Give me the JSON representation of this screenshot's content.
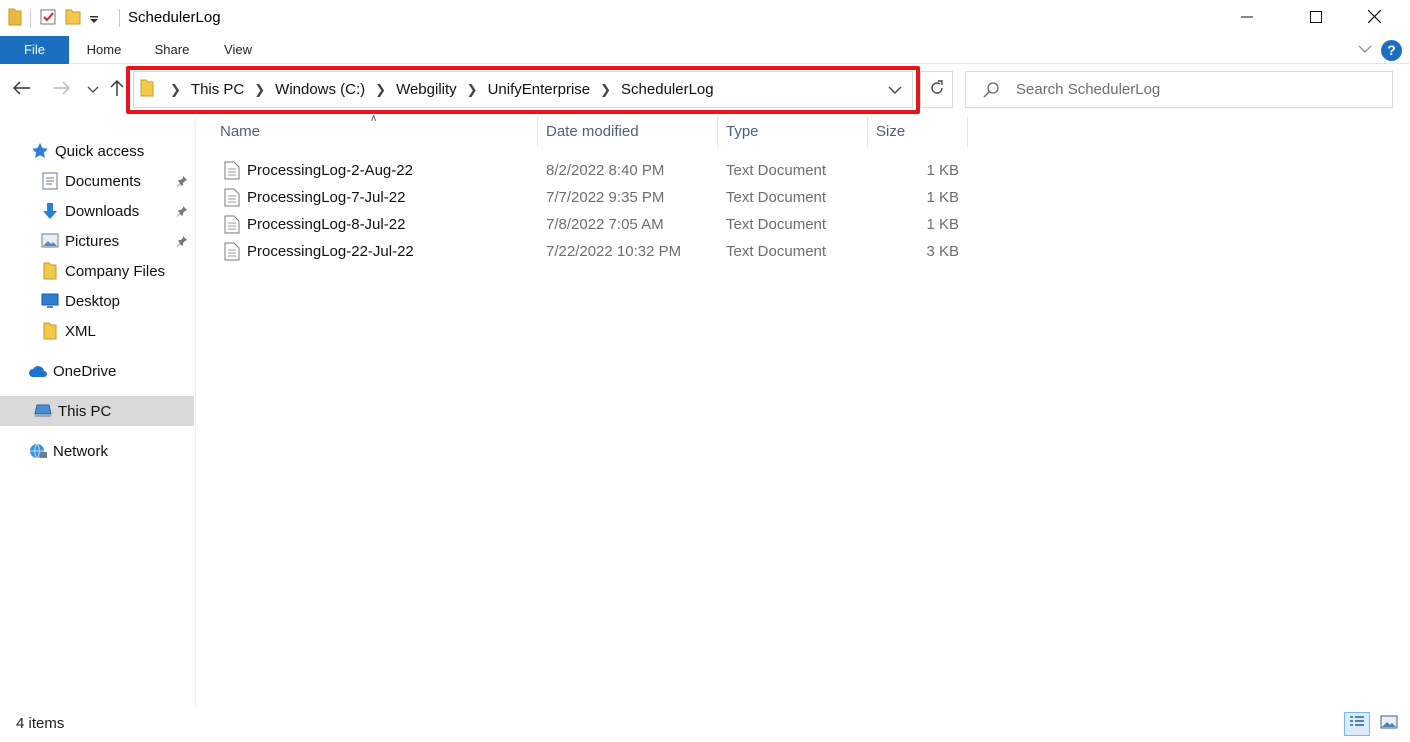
{
  "window": {
    "title": "SchedulerLog",
    "minimize_icon": "minimize-icon",
    "maximize_icon": "maximize-icon",
    "close_icon": "close-icon"
  },
  "ribbon": {
    "tabs": [
      "File",
      "Home",
      "Share",
      "View"
    ],
    "active_tab": "File",
    "accent": "#1a6fc1"
  },
  "navigation": {
    "breadcrumbs": [
      "This PC",
      "Windows (C:)",
      "Webgility",
      "UnifyEnterprise",
      "SchedulerLog"
    ],
    "highlight_color": "#e8141c",
    "search_placeholder": "Search SchedulerLog"
  },
  "sidebar": {
    "items": [
      {
        "label": "Quick access",
        "icon": "star-icon",
        "pinned": false
      },
      {
        "label": "Documents",
        "icon": "documents-icon",
        "pinned": true
      },
      {
        "label": "Downloads",
        "icon": "download-arrow-icon",
        "pinned": true
      },
      {
        "label": "Pictures",
        "icon": "pictures-icon",
        "pinned": true
      },
      {
        "label": "Company Files",
        "icon": "folder-icon",
        "pinned": false
      },
      {
        "label": "Desktop",
        "icon": "desktop-icon",
        "pinned": false
      },
      {
        "label": "XML",
        "icon": "folder-icon",
        "pinned": false
      },
      {
        "label": "OneDrive",
        "icon": "cloud-icon",
        "pinned": false
      },
      {
        "label": "This PC",
        "icon": "computer-icon",
        "pinned": false,
        "selected": true
      },
      {
        "label": "Network",
        "icon": "network-icon",
        "pinned": false
      }
    ]
  },
  "file_list": {
    "columns": [
      "Name",
      "Date modified",
      "Type",
      "Size"
    ],
    "sorted_by": "Name",
    "rows": [
      {
        "name": "ProcessingLog-2-Aug-22",
        "date": "8/2/2022 8:40 PM",
        "type": "Text Document",
        "size": "1 KB"
      },
      {
        "name": "ProcessingLog-7-Jul-22",
        "date": "7/7/2022 9:35 PM",
        "type": "Text Document",
        "size": "1 KB"
      },
      {
        "name": "ProcessingLog-8-Jul-22",
        "date": "7/8/2022 7:05 AM",
        "type": "Text Document",
        "size": "1 KB"
      },
      {
        "name": "ProcessingLog-22-Jul-22",
        "date": "7/22/2022 10:32 PM",
        "type": "Text Document",
        "size": "3 KB"
      }
    ]
  },
  "status_bar": {
    "item_count": "4 items",
    "view_modes": [
      "details-view-icon",
      "large-icons-view-icon"
    ],
    "active_view": "details-view-icon"
  }
}
